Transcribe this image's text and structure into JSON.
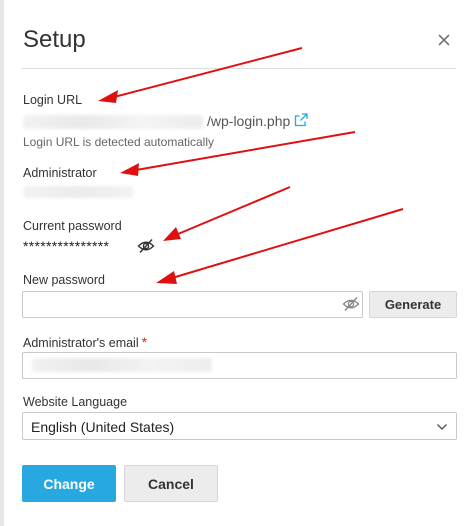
{
  "dialog": {
    "title": "Setup",
    "close_icon": "close-icon"
  },
  "login_url": {
    "label": "Login URL",
    "path": "/wp-login.php",
    "hint": "Login URL is detected automatically",
    "external_icon": "external-link-icon"
  },
  "administrator": {
    "label": "Administrator"
  },
  "current_password": {
    "label": "Current password",
    "masked_value": "***************",
    "toggle_icon": "eye-slash-icon"
  },
  "new_password": {
    "label": "New password",
    "value": "",
    "toggle_icon": "eye-slash-icon",
    "generate_label": "Generate"
  },
  "email": {
    "label": "Administrator's email",
    "required_mark": "*"
  },
  "language": {
    "label": "Website Language",
    "selected": "English (United States)"
  },
  "actions": {
    "change_label": "Change",
    "cancel_label": "Cancel"
  },
  "colors": {
    "primary_button": "#28a8e0",
    "required": "#d02b2b",
    "annotation_arrow": "#e01010",
    "link_icon": "#28a8e0"
  }
}
